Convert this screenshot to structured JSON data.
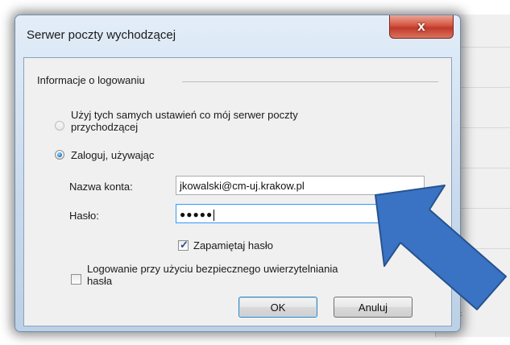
{
  "dialog": {
    "title": "Serwer poczty wychodzącej",
    "close_label": "x"
  },
  "group": {
    "label": "Informacje o logowaniu"
  },
  "options": {
    "same_settings_line1": "Użyj tych samych ustawień co mój serwer poczty",
    "same_settings_line2": "przychodzącej",
    "login_using": "Zaloguj, używając"
  },
  "account": {
    "label": "Nazwa konta:",
    "value": "jkowalski@cm-uj.krakow.pl"
  },
  "password": {
    "label": "Hasło:",
    "masked": "●●●●●"
  },
  "remember_password": {
    "label": "Zapamiętaj hasło",
    "checked": true
  },
  "secure_auth": {
    "line1": "Logowanie przy użyciu bezpiecznego uwierzytelniania",
    "line2": "hasła",
    "checked": false
  },
  "buttons": {
    "ok": "OK",
    "cancel": "Anuluj"
  },
  "background": {
    "edge_text": "ść"
  },
  "colors": {
    "arrow_fill": "#3a73c4",
    "arrow_stroke": "#27538f",
    "close_button": "#c0392b"
  }
}
